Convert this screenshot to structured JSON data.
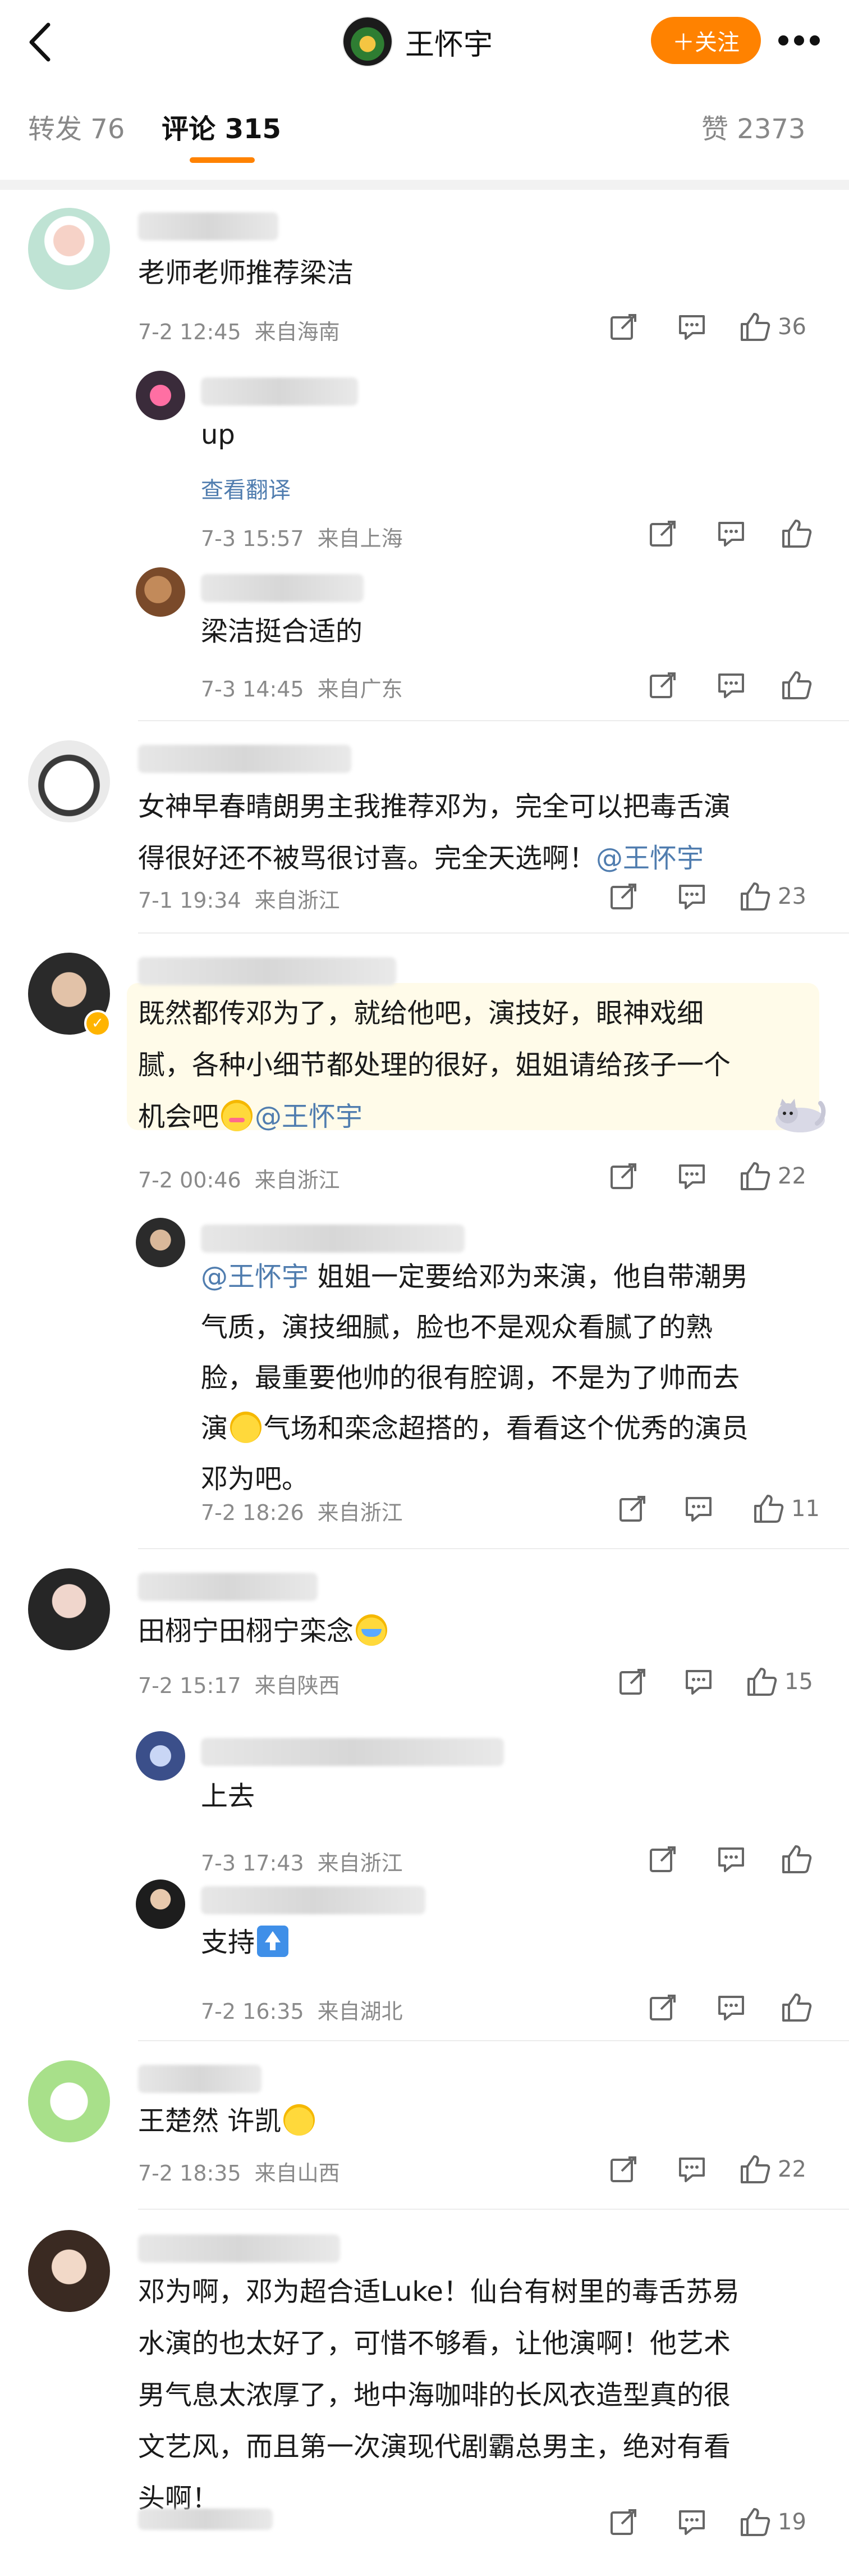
{
  "header": {
    "title": "王怀宇",
    "follow_label": "＋关注"
  },
  "tabs": [
    {
      "label": "转发",
      "count": "76"
    },
    {
      "label": "评论",
      "count": "315"
    },
    {
      "label": "赞",
      "count": "2373"
    }
  ],
  "comments": [
    {
      "text": "老师老师推荐梁洁",
      "time": "7-2 12:45",
      "location": "来自海南",
      "likes": "36",
      "replies": [
        {
          "text": "up",
          "time": "7-3 15:57",
          "location": "来自上海",
          "translate": "查看翻译"
        },
        {
          "text": "梁洁挺合适的",
          "time": "7-3 14:45",
          "location": "来自广东"
        }
      ]
    },
    {
      "text_line1": "女神早春晴朗男主我推荐邓为，完全可以把毒舌演",
      "text_line2": "得很好还不被骂很讨喜。完全天选啊！",
      "mention": "@王怀宇",
      "time": "7-1 19:34",
      "location": "来自浙江",
      "likes": "23"
    },
    {
      "text_line1": "既然都传邓为了，就给他吧，演技好，眼神戏细",
      "text_line2": "腻，各种小细节都处理的很好，姐姐请给孩子一个",
      "text_line3": "机会吧",
      "mention": "@王怀宇",
      "time": "7-2 00:46",
      "location": "来自浙江",
      "likes": "22",
      "replies": [
        {
          "mention": "@王怀宇",
          "line1": "姐姐一定要给邓为来演，他自带潮男",
          "line2": "气质，演技细腻，脸也不是观众看腻了的熟",
          "line3": "脸，最重要他帅的很有腔调，不是为了帅而去",
          "line4a": "演",
          "line4b": "气场和栾念超搭的，看看这个优秀的演员",
          "line5": "邓为吧。",
          "time": "7-2 18:26",
          "location": "来自浙江",
          "likes": "11"
        }
      ]
    },
    {
      "text": "田栩宁田栩宁栾念",
      "time": "7-2 15:17",
      "location": "来自陕西",
      "likes": "15",
      "replies": [
        {
          "text": "上去",
          "time": "7-3 17:43",
          "location": "来自浙江"
        },
        {
          "text": "支持",
          "time": "7-2 16:35",
          "location": "来自湖北"
        }
      ]
    },
    {
      "text": "王楚然 许凯",
      "time": "7-2 18:35",
      "location": "来自山西",
      "likes": "22"
    },
    {
      "line1": "邓为啊，邓为超合适Luke！仙台有树里的毒舌苏易",
      "line2": "水演的也太好了，可惜不够看，让他演啊！他艺术",
      "line3": "男气息太浓厚了，地中海咖啡的长风衣造型真的很",
      "line4": "文艺风，而且第一次演现代剧霸总男主，绝对有看",
      "line5": "头啊！",
      "likes": "19"
    }
  ],
  "colors": {
    "accent": "#ff8200",
    "link": "#507daf",
    "meta": "#8a8a8a"
  }
}
